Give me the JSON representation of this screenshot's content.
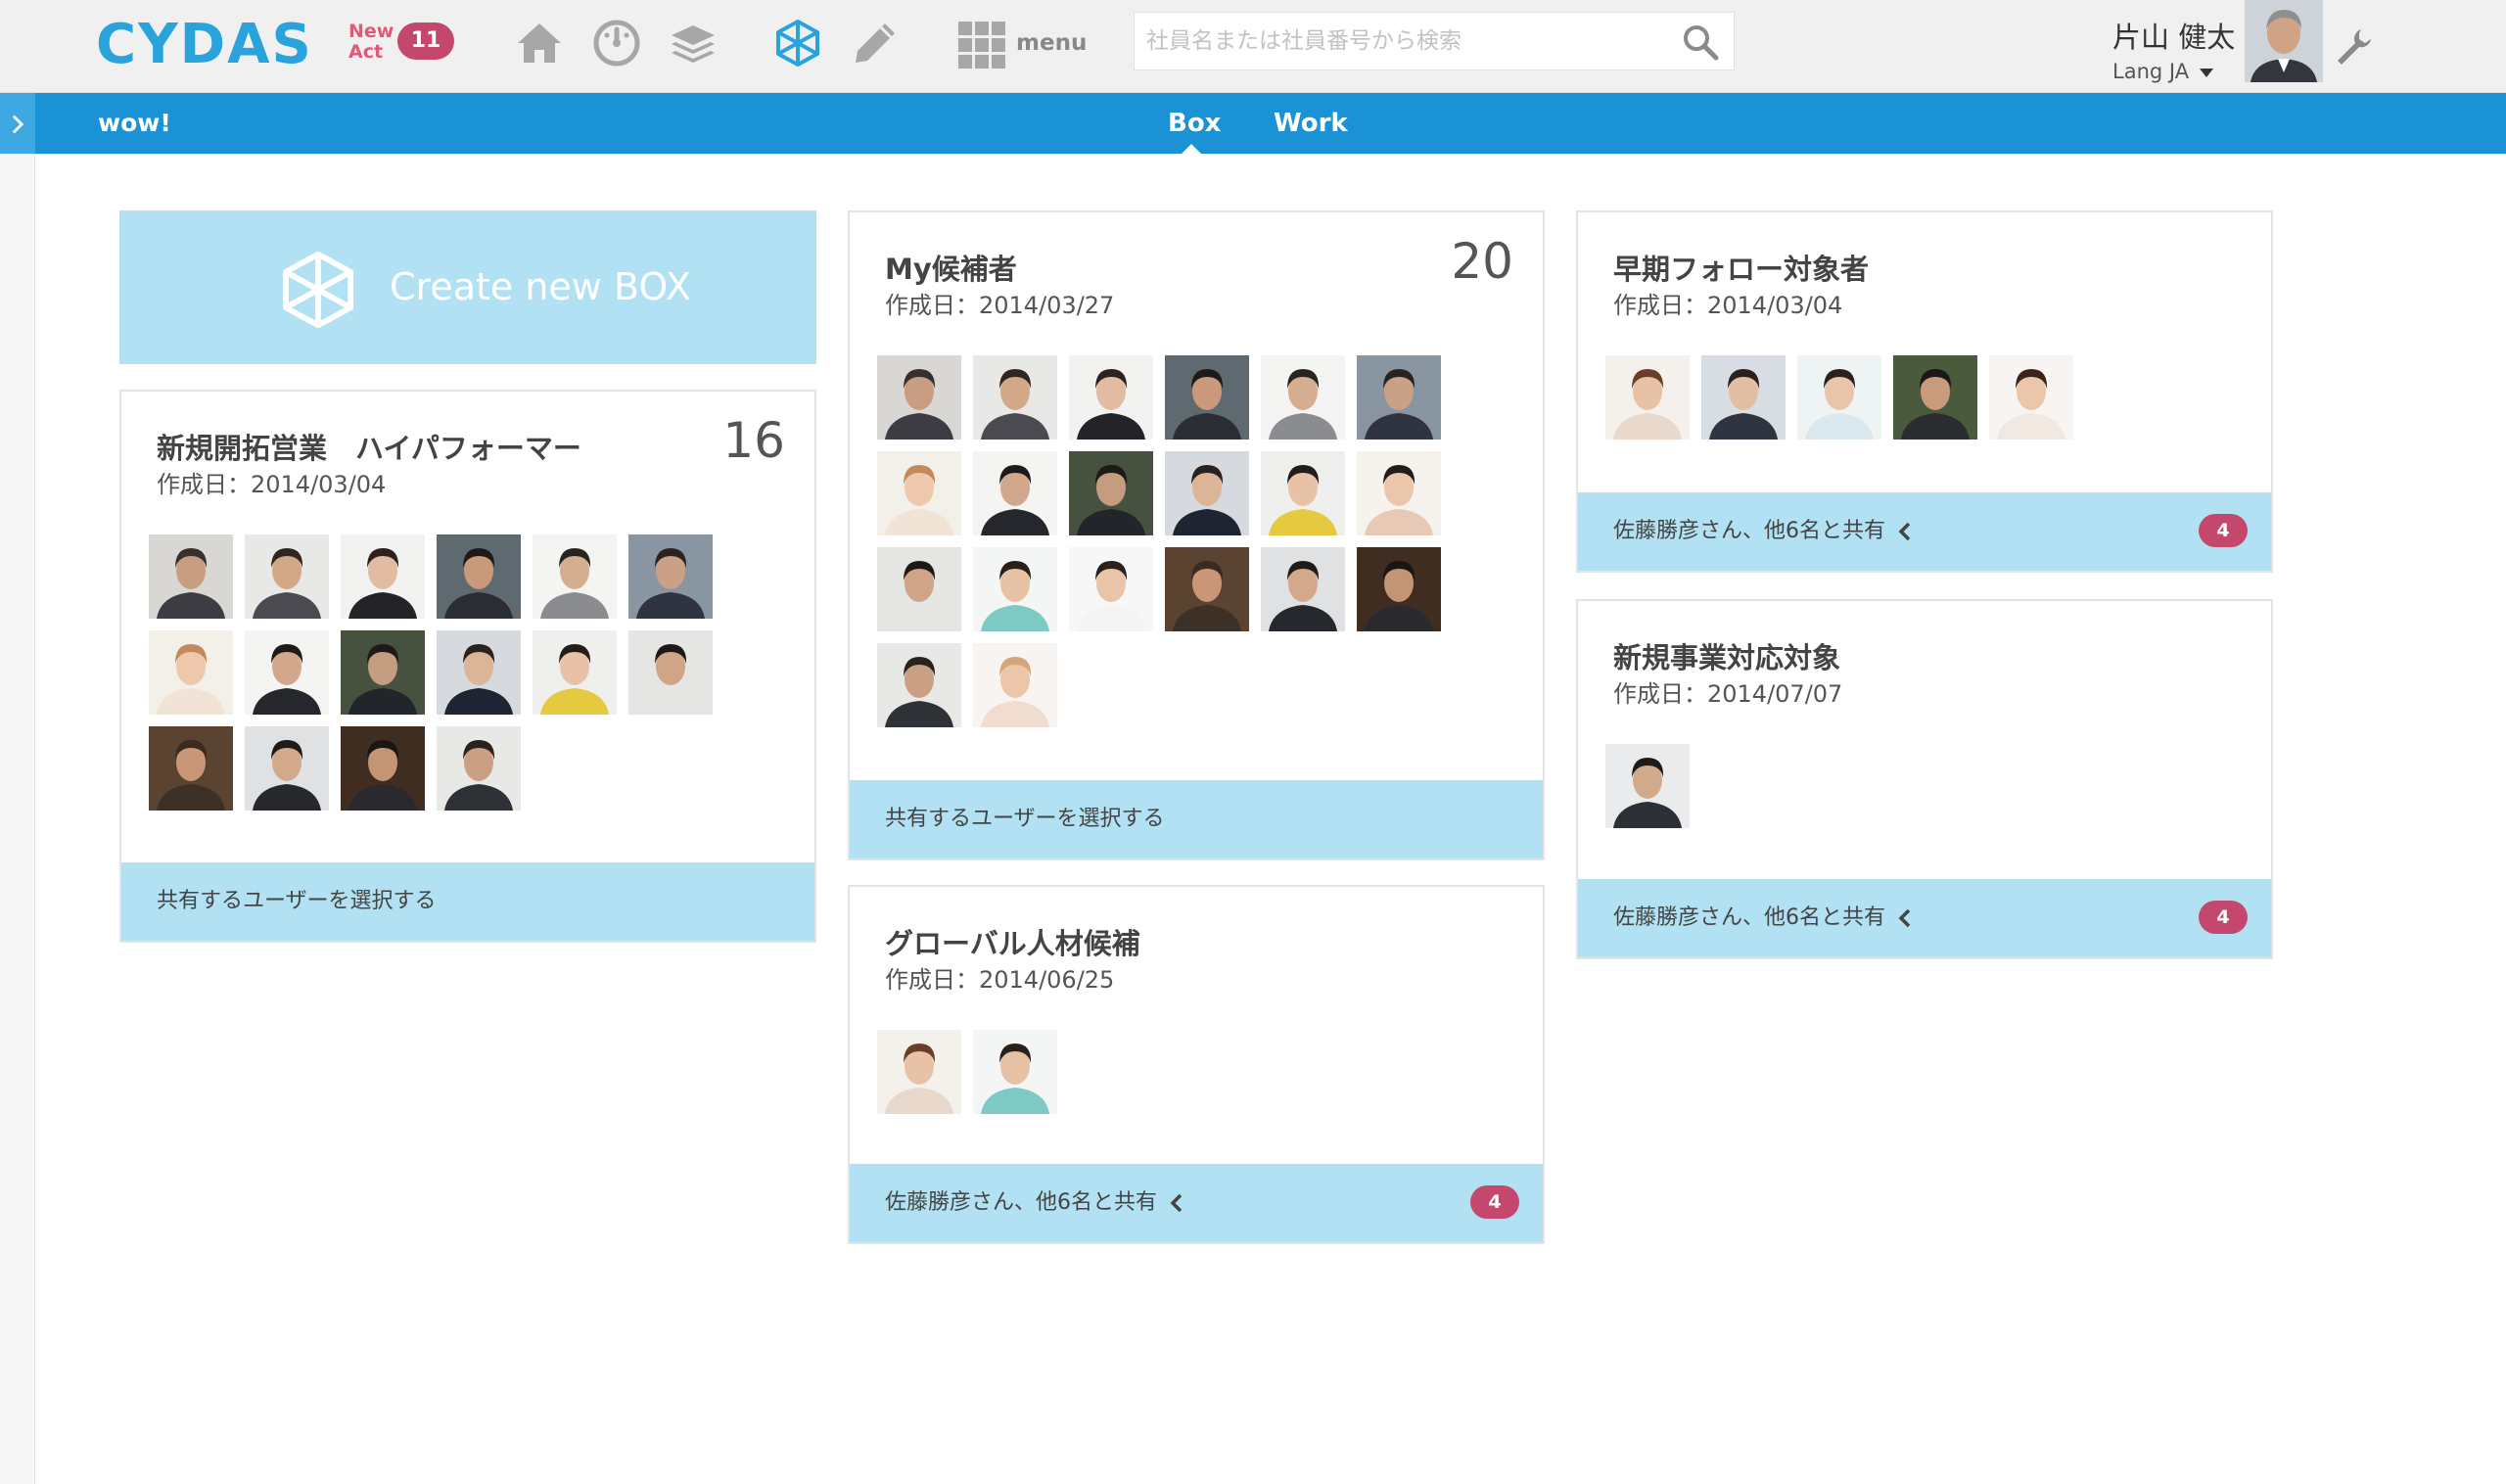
{
  "header": {
    "logo": "CYDAS",
    "new_act_line1": "New",
    "new_act_line2": "Act",
    "notification_count": "11",
    "menu_label": "menu",
    "search_placeholder": "社員名または社員番号から検索",
    "search_value": "",
    "user_name": "片山 健太",
    "language": "Lang JA"
  },
  "subbar": {
    "title": "wow!",
    "tabs": [
      {
        "label": "Box",
        "active": true
      },
      {
        "label": "Work",
        "active": false
      }
    ]
  },
  "create_box": {
    "label": "Create new BOX"
  },
  "cards": [
    {
      "title": "新規開拓営業　ハイパフォーマー",
      "date": "作成日：2014/03/04",
      "count": "16",
      "footer_text": "共有するユーザーを選択する",
      "footer_badge": "",
      "photos": [
        {
          "bg": "#d9d7d3",
          "skin": "#c99d82",
          "hair": "#3a302b",
          "suit": "#3c3c42"
        },
        {
          "bg": "#e8e8e6",
          "skin": "#d3a887",
          "hair": "#2f2621",
          "suit": "#4a4a50"
        },
        {
          "bg": "#f2f2f0",
          "skin": "#e2bca2",
          "hair": "#2c2320",
          "suit": "#232328"
        },
        {
          "bg": "#5f6a70",
          "skin": "#c8997a",
          "hair": "#1e1a18",
          "suit": "#2b2d33"
        },
        {
          "bg": "#f4f4f2",
          "skin": "#d5ae92",
          "hair": "#2a2420",
          "suit": "#8a8c90"
        },
        {
          "bg": "#8a95a2",
          "skin": "#caa086",
          "hair": "#2a2420",
          "suit": "#2f3440"
        },
        {
          "bg": "#f3efe9",
          "skin": "#edc8ad",
          "hair": "#c2895a",
          "suit": "#f1e4d6"
        },
        {
          "bg": "#f4f4f2",
          "skin": "#d1a88b",
          "hair": "#1f1a17",
          "suit": "#25272c"
        },
        {
          "bg": "#46513f",
          "skin": "#c49c80",
          "hair": "#1e1a18",
          "suit": "#22252a"
        },
        {
          "bg": "#d6d9dd",
          "skin": "#dcb498",
          "hair": "#2b221e",
          "suit": "#1f2433"
        },
        {
          "bg": "#efefed",
          "skin": "#e8c2a6",
          "hair": "#231c19",
          "suit": "#e5c93e"
        },
        {
          "bg": "#e5e5e3",
          "skin": "#cfa487",
          "hair": "#1e1917",
          "suit": "#e5e5e3"
        },
        {
          "bg": "#5a4330",
          "skin": "#c99777",
          "hair": "#3b2a1f",
          "suit": "#3d3026"
        },
        {
          "bg": "#dfe1e3",
          "skin": "#d2a98b",
          "hair": "#1f1b18",
          "suit": "#26282d"
        },
        {
          "bg": "#3f2d22",
          "skin": "#c49574",
          "hair": "#1b1613",
          "suit": "#2a2a2e"
        },
        {
          "bg": "#e8e8e6",
          "skin": "#caa084",
          "hair": "#2a221e",
          "suit": "#2e3136"
        }
      ]
    },
    {
      "title": "My候補者",
      "date": "作成日：2014/03/27",
      "count": "20",
      "footer_text": "共有するユーザーを選択する",
      "footer_badge": "",
      "photos": [
        {
          "bg": "#d9d7d3",
          "skin": "#c99d82",
          "hair": "#3a302b",
          "suit": "#3c3c42"
        },
        {
          "bg": "#e8e8e6",
          "skin": "#d3a887",
          "hair": "#2f2621",
          "suit": "#4a4a50"
        },
        {
          "bg": "#f2f2f0",
          "skin": "#e2bca2",
          "hair": "#2c2320",
          "suit": "#232328"
        },
        {
          "bg": "#5f6a70",
          "skin": "#c8997a",
          "hair": "#1e1a18",
          "suit": "#2b2d33"
        },
        {
          "bg": "#f4f4f2",
          "skin": "#d5ae92",
          "hair": "#2a2420",
          "suit": "#8a8c90"
        },
        {
          "bg": "#8a95a2",
          "skin": "#caa086",
          "hair": "#2a2420",
          "suit": "#2f3440"
        },
        {
          "bg": "#f3efe9",
          "skin": "#edc8ad",
          "hair": "#c2895a",
          "suit": "#f1e4d6"
        },
        {
          "bg": "#f4f4f2",
          "skin": "#d1a88b",
          "hair": "#1f1a17",
          "suit": "#25272c"
        },
        {
          "bg": "#46513f",
          "skin": "#c49c80",
          "hair": "#1e1a18",
          "suit": "#22252a"
        },
        {
          "bg": "#d6d9dd",
          "skin": "#dcb498",
          "hair": "#2b221e",
          "suit": "#1f2433"
        },
        {
          "bg": "#efefed",
          "skin": "#e8c2a6",
          "hair": "#231c19",
          "suit": "#e5c93e"
        },
        {
          "bg": "#f6f2ee",
          "skin": "#eac6ab",
          "hair": "#231c19",
          "suit": "#e8c9b5"
        },
        {
          "bg": "#e5e5e3",
          "skin": "#cfa487",
          "hair": "#1e1917",
          "suit": "#e5e5e3"
        },
        {
          "bg": "#f4f6f5",
          "skin": "#e6c1a4",
          "hair": "#2a201b",
          "suit": "#7dc9c4"
        },
        {
          "bg": "#f7f7f7",
          "skin": "#e8c4a8",
          "hair": "#2b211c",
          "suit": "#f4f4f4"
        },
        {
          "bg": "#5a4330",
          "skin": "#c99777",
          "hair": "#3b2a1f",
          "suit": "#3d3026"
        },
        {
          "bg": "#dfe1e3",
          "skin": "#d2a98b",
          "hair": "#1f1b18",
          "suit": "#26282d"
        },
        {
          "bg": "#3f2d22",
          "skin": "#c49574",
          "hair": "#1b1613",
          "suit": "#2a2a2e"
        },
        {
          "bg": "#e8e8e6",
          "skin": "#caa084",
          "hair": "#2a221e",
          "suit": "#2e3136"
        },
        {
          "bg": "#f7f4f1",
          "skin": "#ecc6aa",
          "hair": "#d4a47a",
          "suit": "#f1dcd0"
        }
      ]
    },
    {
      "title": "グローバル人材候補",
      "date": "作成日：2014/06/25",
      "count": "",
      "footer_text": "佐藤勝彦さん、他6名と共有",
      "footer_badge": "4",
      "photos": [
        {
          "bg": "#f4f0ec",
          "skin": "#e8c2a6",
          "hair": "#6a3e2a",
          "suit": "#e9d8cc"
        },
        {
          "bg": "#f4f6f5",
          "skin": "#e6c1a4",
          "hair": "#2a201b",
          "suit": "#7dc9c4"
        }
      ]
    },
    {
      "title": "早期フォロー対象者",
      "date": "作成日：2014/03/04",
      "count": "",
      "footer_text": "佐藤勝彦さん、他6名と共有",
      "footer_badge": "4",
      "photos": [
        {
          "bg": "#f4f0ec",
          "skin": "#e8c2a6",
          "hair": "#6a3e2a",
          "suit": "#e9d8cc"
        },
        {
          "bg": "#d7dde2",
          "skin": "#e3bea2",
          "hair": "#2b211c",
          "suit": "#2f3440"
        },
        {
          "bg": "#eef3f4",
          "skin": "#e8c4a8",
          "hair": "#2b211c",
          "suit": "#dbe8ee"
        },
        {
          "bg": "#4a5a3d",
          "skin": "#c99b7c",
          "hair": "#1d1815",
          "suit": "#2a2c30"
        },
        {
          "bg": "#f7f4f1",
          "skin": "#ecc6aa",
          "hair": "#3a241a",
          "suit": "#f1e8e2"
        }
      ]
    },
    {
      "title": "新規事業対応対象",
      "date": "作成日：2014/07/07",
      "count": "",
      "footer_text": "佐藤勝彦さん、他6名と共有",
      "footer_badge": "4",
      "photos": [
        {
          "bg": "#e9ebec",
          "skin": "#d2a98b",
          "hair": "#1f1b18",
          "suit": "#2c2f35"
        }
      ]
    }
  ],
  "colors": {
    "brand_blue": "#2aa3dc",
    "subbar_blue": "#1b91d6",
    "card_footer": "#b1e1f2",
    "badge_pink": "#c4486e"
  },
  "icons": [
    "home-icon",
    "dashboard-icon",
    "layers-icon",
    "box-icon",
    "pencil-icon",
    "grid-menu-icon",
    "search-icon",
    "wrench-icon",
    "chevron-left-icon",
    "chevron-right-icon"
  ]
}
